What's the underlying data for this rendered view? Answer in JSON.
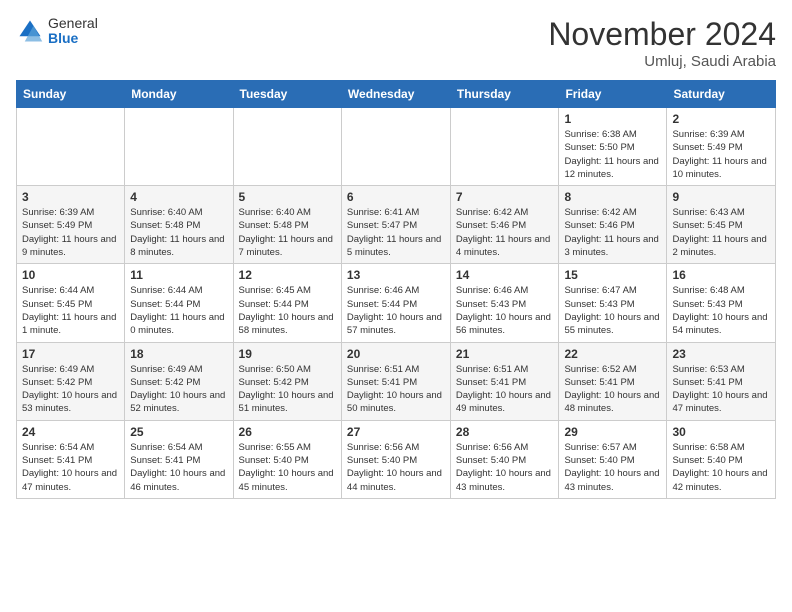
{
  "logo": {
    "general": "General",
    "blue": "Blue"
  },
  "header": {
    "month": "November 2024",
    "location": "Umluj, Saudi Arabia"
  },
  "weekdays": [
    "Sunday",
    "Monday",
    "Tuesday",
    "Wednesday",
    "Thursday",
    "Friday",
    "Saturday"
  ],
  "weeks": [
    [
      {
        "day": "",
        "info": ""
      },
      {
        "day": "",
        "info": ""
      },
      {
        "day": "",
        "info": ""
      },
      {
        "day": "",
        "info": ""
      },
      {
        "day": "",
        "info": ""
      },
      {
        "day": "1",
        "info": "Sunrise: 6:38 AM\nSunset: 5:50 PM\nDaylight: 11 hours and 12 minutes."
      },
      {
        "day": "2",
        "info": "Sunrise: 6:39 AM\nSunset: 5:49 PM\nDaylight: 11 hours and 10 minutes."
      }
    ],
    [
      {
        "day": "3",
        "info": "Sunrise: 6:39 AM\nSunset: 5:49 PM\nDaylight: 11 hours and 9 minutes."
      },
      {
        "day": "4",
        "info": "Sunrise: 6:40 AM\nSunset: 5:48 PM\nDaylight: 11 hours and 8 minutes."
      },
      {
        "day": "5",
        "info": "Sunrise: 6:40 AM\nSunset: 5:48 PM\nDaylight: 11 hours and 7 minutes."
      },
      {
        "day": "6",
        "info": "Sunrise: 6:41 AM\nSunset: 5:47 PM\nDaylight: 11 hours and 5 minutes."
      },
      {
        "day": "7",
        "info": "Sunrise: 6:42 AM\nSunset: 5:46 PM\nDaylight: 11 hours and 4 minutes."
      },
      {
        "day": "8",
        "info": "Sunrise: 6:42 AM\nSunset: 5:46 PM\nDaylight: 11 hours and 3 minutes."
      },
      {
        "day": "9",
        "info": "Sunrise: 6:43 AM\nSunset: 5:45 PM\nDaylight: 11 hours and 2 minutes."
      }
    ],
    [
      {
        "day": "10",
        "info": "Sunrise: 6:44 AM\nSunset: 5:45 PM\nDaylight: 11 hours and 1 minute."
      },
      {
        "day": "11",
        "info": "Sunrise: 6:44 AM\nSunset: 5:44 PM\nDaylight: 11 hours and 0 minutes."
      },
      {
        "day": "12",
        "info": "Sunrise: 6:45 AM\nSunset: 5:44 PM\nDaylight: 10 hours and 58 minutes."
      },
      {
        "day": "13",
        "info": "Sunrise: 6:46 AM\nSunset: 5:44 PM\nDaylight: 10 hours and 57 minutes."
      },
      {
        "day": "14",
        "info": "Sunrise: 6:46 AM\nSunset: 5:43 PM\nDaylight: 10 hours and 56 minutes."
      },
      {
        "day": "15",
        "info": "Sunrise: 6:47 AM\nSunset: 5:43 PM\nDaylight: 10 hours and 55 minutes."
      },
      {
        "day": "16",
        "info": "Sunrise: 6:48 AM\nSunset: 5:43 PM\nDaylight: 10 hours and 54 minutes."
      }
    ],
    [
      {
        "day": "17",
        "info": "Sunrise: 6:49 AM\nSunset: 5:42 PM\nDaylight: 10 hours and 53 minutes."
      },
      {
        "day": "18",
        "info": "Sunrise: 6:49 AM\nSunset: 5:42 PM\nDaylight: 10 hours and 52 minutes."
      },
      {
        "day": "19",
        "info": "Sunrise: 6:50 AM\nSunset: 5:42 PM\nDaylight: 10 hours and 51 minutes."
      },
      {
        "day": "20",
        "info": "Sunrise: 6:51 AM\nSunset: 5:41 PM\nDaylight: 10 hours and 50 minutes."
      },
      {
        "day": "21",
        "info": "Sunrise: 6:51 AM\nSunset: 5:41 PM\nDaylight: 10 hours and 49 minutes."
      },
      {
        "day": "22",
        "info": "Sunrise: 6:52 AM\nSunset: 5:41 PM\nDaylight: 10 hours and 48 minutes."
      },
      {
        "day": "23",
        "info": "Sunrise: 6:53 AM\nSunset: 5:41 PM\nDaylight: 10 hours and 47 minutes."
      }
    ],
    [
      {
        "day": "24",
        "info": "Sunrise: 6:54 AM\nSunset: 5:41 PM\nDaylight: 10 hours and 47 minutes."
      },
      {
        "day": "25",
        "info": "Sunrise: 6:54 AM\nSunset: 5:41 PM\nDaylight: 10 hours and 46 minutes."
      },
      {
        "day": "26",
        "info": "Sunrise: 6:55 AM\nSunset: 5:40 PM\nDaylight: 10 hours and 45 minutes."
      },
      {
        "day": "27",
        "info": "Sunrise: 6:56 AM\nSunset: 5:40 PM\nDaylight: 10 hours and 44 minutes."
      },
      {
        "day": "28",
        "info": "Sunrise: 6:56 AM\nSunset: 5:40 PM\nDaylight: 10 hours and 43 minutes."
      },
      {
        "day": "29",
        "info": "Sunrise: 6:57 AM\nSunset: 5:40 PM\nDaylight: 10 hours and 43 minutes."
      },
      {
        "day": "30",
        "info": "Sunrise: 6:58 AM\nSunset: 5:40 PM\nDaylight: 10 hours and 42 minutes."
      }
    ]
  ]
}
